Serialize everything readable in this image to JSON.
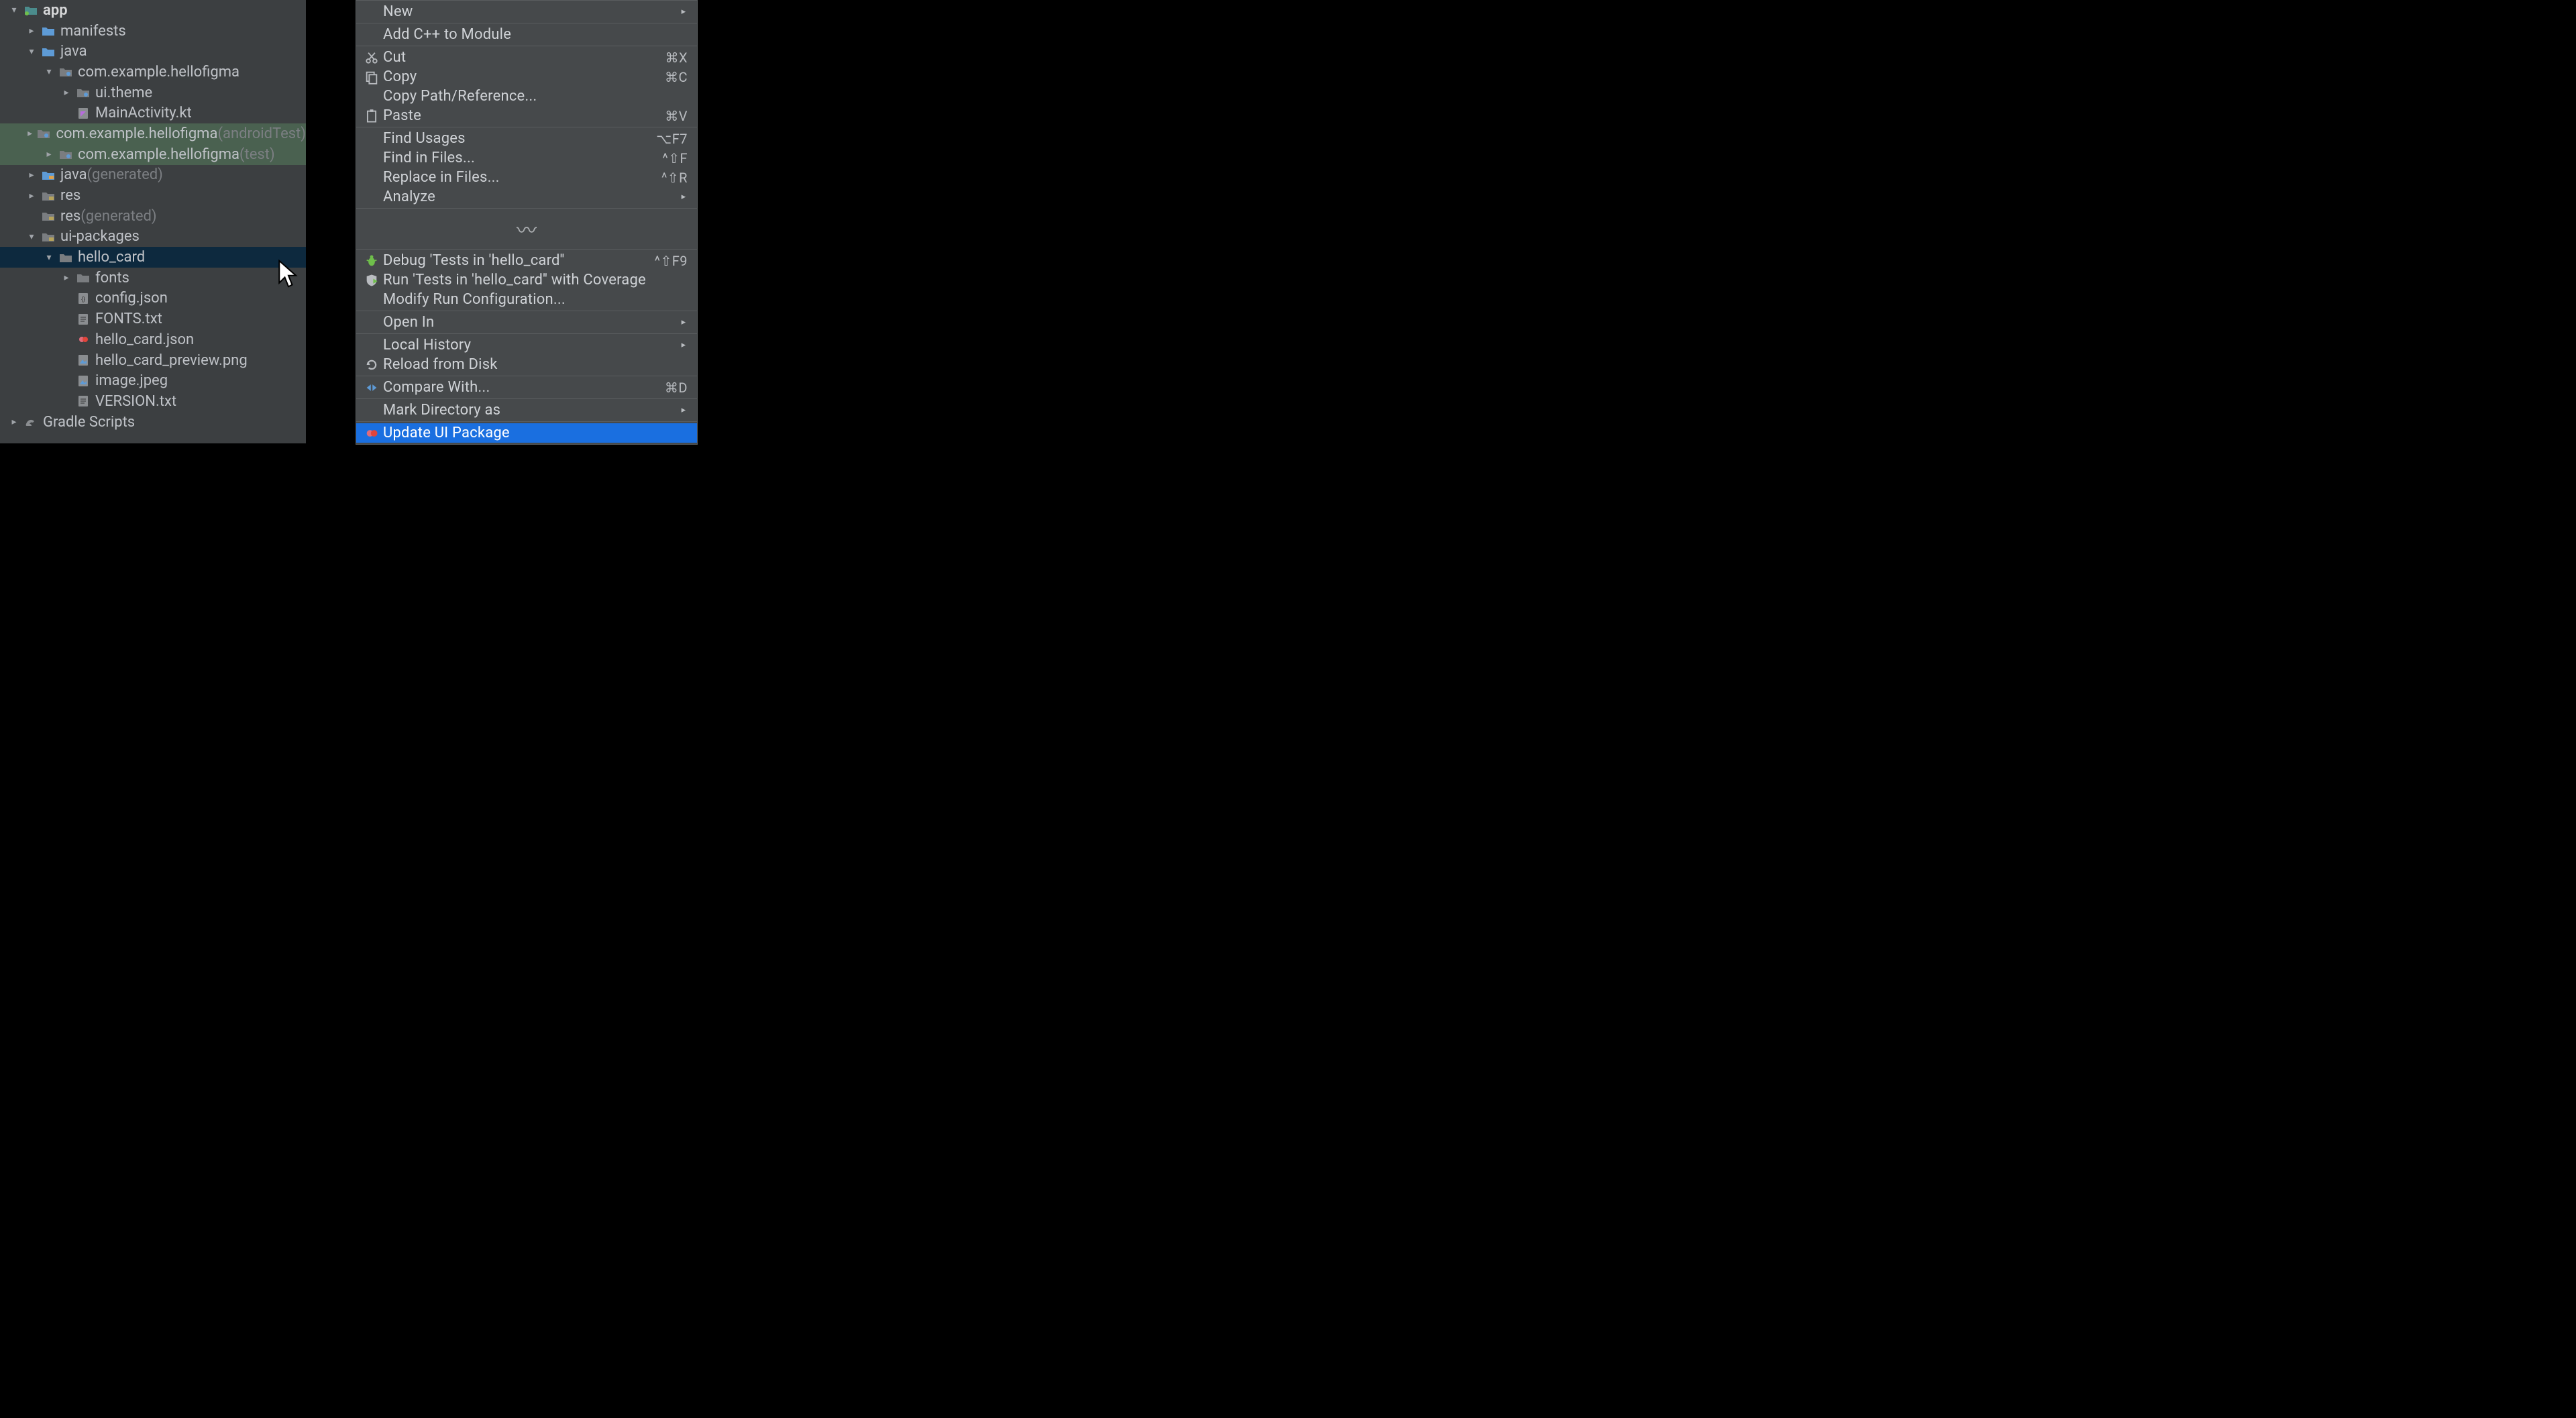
{
  "tree": {
    "rows": [
      {
        "indent": 0,
        "chevron": "down",
        "icon": "module-folder",
        "label": "app",
        "bold": true
      },
      {
        "indent": 1,
        "chevron": "right",
        "icon": "folder-blue",
        "label": "manifests"
      },
      {
        "indent": 1,
        "chevron": "down",
        "icon": "folder-blue",
        "label": "java"
      },
      {
        "indent": 2,
        "chevron": "down",
        "icon": "package-folder",
        "label": "com.example.hellofigma"
      },
      {
        "indent": 3,
        "chevron": "right",
        "icon": "package-folder",
        "label": "ui.theme"
      },
      {
        "indent": 3,
        "chevron": "none",
        "icon": "kotlin-file",
        "label": "MainActivity.kt"
      },
      {
        "indent": 2,
        "chevron": "right",
        "icon": "package-folder",
        "label": "com.example.hellofigma",
        "suffix": "(androidTest)",
        "dim": true
      },
      {
        "indent": 2,
        "chevron": "right",
        "icon": "package-folder",
        "label": "com.example.hellofigma",
        "suffix": "(test)",
        "dim": true
      },
      {
        "indent": 1,
        "chevron": "right",
        "icon": "folder-gen",
        "label": "java",
        "suffix": "(generated)"
      },
      {
        "indent": 1,
        "chevron": "right",
        "icon": "folder-res",
        "label": "res"
      },
      {
        "indent": 1,
        "chevron": "none",
        "icon": "folder-res",
        "label": "res",
        "suffix": "(generated)"
      },
      {
        "indent": 1,
        "chevron": "down",
        "icon": "folder-res",
        "label": "ui-packages"
      },
      {
        "indent": 2,
        "chevron": "down",
        "icon": "folder-dim",
        "label": "hello_card",
        "selected": true
      },
      {
        "indent": 3,
        "chevron": "right",
        "icon": "folder-dim",
        "label": "fonts"
      },
      {
        "indent": 3,
        "chevron": "none",
        "icon": "json-file",
        "label": "config.json"
      },
      {
        "indent": 3,
        "chevron": "none",
        "icon": "text-file",
        "label": "FONTS.txt"
      },
      {
        "indent": 3,
        "chevron": "none",
        "icon": "figma-file",
        "label": "hello_card.json"
      },
      {
        "indent": 3,
        "chevron": "none",
        "icon": "image-file",
        "label": "hello_card_preview.png"
      },
      {
        "indent": 3,
        "chevron": "none",
        "icon": "image-file",
        "label": "image.jpeg"
      },
      {
        "indent": 3,
        "chevron": "none",
        "icon": "text-file",
        "label": "VERSION.txt"
      },
      {
        "indent": 0,
        "chevron": "right",
        "icon": "gradle",
        "label": "Gradle Scripts"
      }
    ]
  },
  "menu": {
    "groups": [
      [
        {
          "label": "New",
          "submenu": true
        }
      ],
      [
        {
          "label": "Add C++ to Module"
        }
      ],
      [
        {
          "icon": "cut",
          "label": "Cut",
          "shortcut": "⌘X"
        },
        {
          "icon": "copy",
          "label": "Copy",
          "shortcut": "⌘C"
        },
        {
          "label": "Copy Path/Reference..."
        },
        {
          "icon": "paste",
          "label": "Paste",
          "shortcut": "⌘V"
        }
      ],
      [
        {
          "label": "Find Usages",
          "shortcut": "⌥F7"
        },
        {
          "label": "Find in Files...",
          "shortcut": "^⇧F"
        },
        {
          "label": "Replace in Files...",
          "shortcut": "^⇧R"
        },
        {
          "label": "Analyze",
          "submenu": true
        }
      ],
      "snip",
      [
        {
          "icon": "bug",
          "label": "Debug 'Tests in 'hello_card''",
          "shortcut": "^⇧F9"
        },
        {
          "icon": "coverage",
          "label": "Run 'Tests in 'hello_card'' with Coverage"
        },
        {
          "label": "Modify Run Configuration..."
        }
      ],
      [
        {
          "label": "Open In",
          "submenu": true
        }
      ],
      [
        {
          "label": "Local History",
          "submenu": true
        },
        {
          "icon": "reload",
          "label": "Reload from Disk"
        }
      ],
      [
        {
          "icon": "compare",
          "label": "Compare With...",
          "shortcut": "⌘D"
        }
      ],
      [
        {
          "label": "Mark Directory as",
          "submenu": true
        }
      ],
      [
        {
          "icon": "figma",
          "label": "Update UI Package",
          "highlight": true
        }
      ]
    ]
  }
}
